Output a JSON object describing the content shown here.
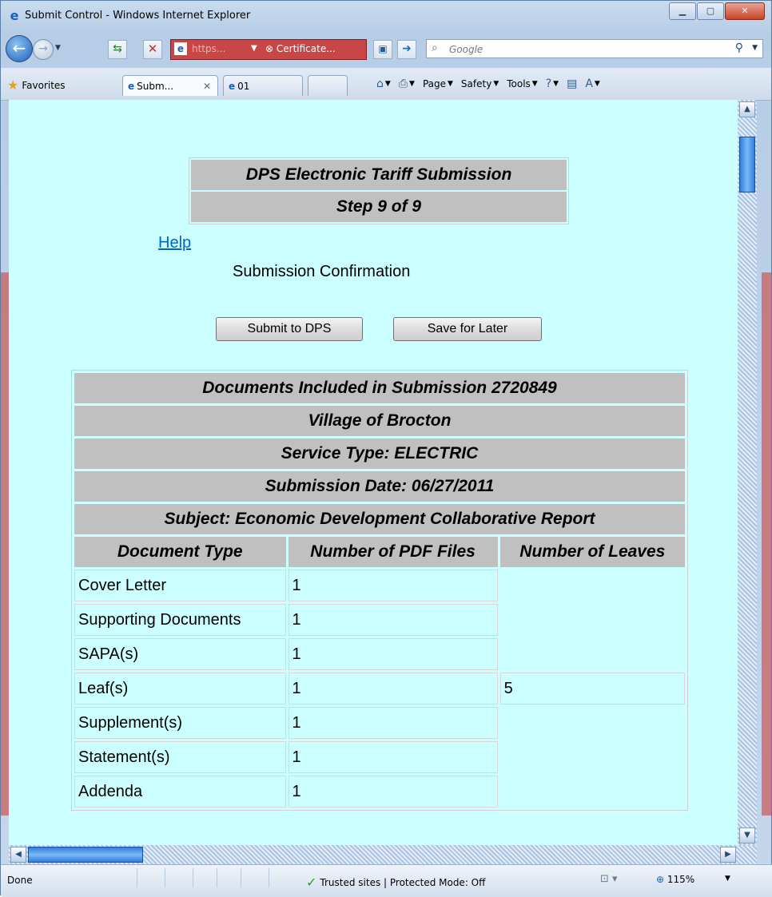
{
  "window": {
    "title": "Submit Control - Windows Internet Explorer"
  },
  "addressbar": {
    "url": "https...",
    "certificate": "Certificate...",
    "search_placeholder": "Google"
  },
  "favorites_bar": {
    "favorites_label": "Favorites",
    "tabs": [
      {
        "label": "Subm...",
        "active": true
      },
      {
        "label": "01",
        "active": false
      }
    ],
    "commands": [
      "Page",
      "Safety",
      "Tools"
    ]
  },
  "page": {
    "header_title": "DPS Electronic Tariff Submission",
    "header_step": "Step 9 of 9",
    "help_link": "Help",
    "subtitle": "Submission Confirmation",
    "buttons": {
      "submit": "Submit to DPS",
      "save": "Save for Later"
    },
    "table": {
      "section_rows": [
        "Documents Included in Submission 2720849",
        "Village of Brocton",
        "Service Type: ELECTRIC",
        "Submission Date: 06/27/2011",
        "Subject: Economic Development Collaborative Report"
      ],
      "columns": [
        "Document Type",
        "Number of PDF Files",
        "Number of Leaves"
      ],
      "rows": [
        {
          "type": "Cover Letter",
          "pdf_files": "1",
          "leaves": ""
        },
        {
          "type": "Supporting Documents",
          "pdf_files": "1",
          "leaves": ""
        },
        {
          "type": "SAPA(s)",
          "pdf_files": "1",
          "leaves": ""
        },
        {
          "type": "Leaf(s)",
          "pdf_files": "1",
          "leaves": "5"
        },
        {
          "type": "Supplement(s)",
          "pdf_files": "1",
          "leaves": ""
        },
        {
          "type": "Statement(s)",
          "pdf_files": "1",
          "leaves": ""
        },
        {
          "type": "Addenda",
          "pdf_files": "1",
          "leaves": ""
        }
      ]
    }
  },
  "statusbar": {
    "status": "Done",
    "zone": "Trusted sites | Protected Mode: Off",
    "zoom": "115%"
  },
  "colors": {
    "page_background": "#ccffff",
    "header_cell": "#c0c0c0",
    "link": "#0066cc"
  }
}
